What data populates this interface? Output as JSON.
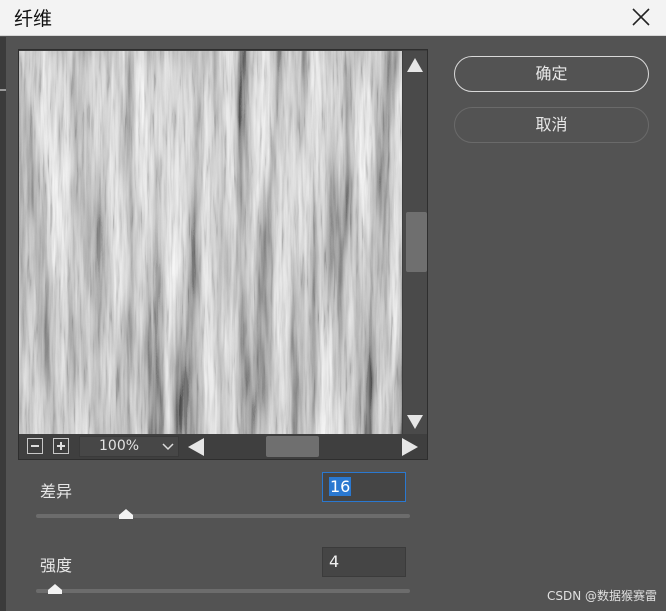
{
  "window": {
    "title": "纤维"
  },
  "buttons": {
    "ok_label": "确定",
    "cancel_label": "取消"
  },
  "preview": {
    "zoom": "100%",
    "texture": "vertical fiber noise, black and white"
  },
  "params": [
    {
      "label": "差异",
      "value": "16",
      "slider_fraction": 0.24,
      "focused": true
    },
    {
      "label": "强度",
      "value": "4",
      "slider_fraction": 0.05,
      "focused": false
    }
  ],
  "watermark": "CSDN @数据猴赛雷",
  "colors": {
    "dialog_bg": "#535353",
    "focus_blue": "#2a78d0"
  }
}
